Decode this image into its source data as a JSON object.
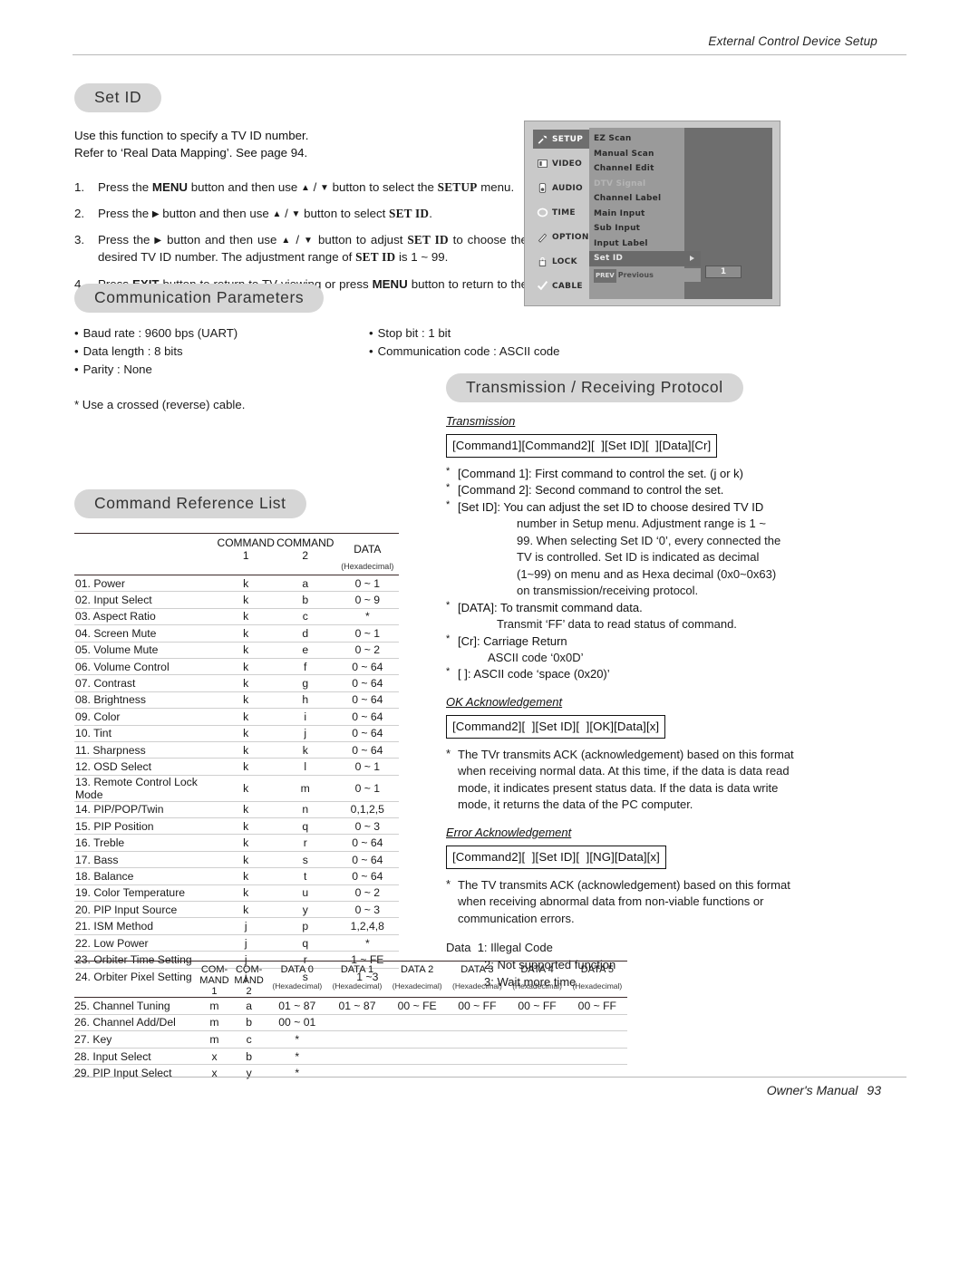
{
  "header": {
    "title": "External Control Device Setup"
  },
  "footer": {
    "manual": "Owner's Manual",
    "page": "93"
  },
  "set_id": {
    "heading": "Set ID",
    "intro_line1": "Use this function to specify a TV ID number.",
    "intro_line2": "Refer to ‘Real Data Mapping’. See page 94.",
    "steps": [
      {
        "num": "1.",
        "parts": [
          "Press the ",
          "MENU",
          " button and then use ",
          "▲",
          " / ",
          "▼",
          " button to select the ",
          "SETUP",
          " menu."
        ]
      },
      {
        "num": "2.",
        "parts": [
          "Press the ",
          "▶",
          " button and then use ",
          "▲",
          " / ",
          "▼",
          " button to select ",
          "SET ID",
          "."
        ]
      },
      {
        "num": "3.",
        "parts": [
          "Press the ",
          "▶",
          " button and then use ",
          "▲",
          " / ",
          "▼",
          " button to adjust ",
          "SET ID",
          " to choose the desired TV ID number. The adjustment range of ",
          "SET ID",
          " is 1 ~ 99."
        ]
      },
      {
        "num": "4.",
        "parts": [
          "Press ",
          "EXIT",
          " button to return to TV viewing or press ",
          "MENU",
          " button to return to the previous menu."
        ]
      }
    ]
  },
  "osd": {
    "sidebar": [
      {
        "label": "SETUP",
        "icon": "wrench-icon",
        "selected": true
      },
      {
        "label": "VIDEO",
        "icon": "screen-icon",
        "selected": false
      },
      {
        "label": "AUDIO",
        "icon": "speaker-icon",
        "selected": false
      },
      {
        "label": "TIME",
        "icon": "clock-icon",
        "selected": false
      },
      {
        "label": "OPTION",
        "icon": "pencil-icon",
        "selected": false
      },
      {
        "label": "LOCK",
        "icon": "lock-icon",
        "selected": false
      },
      {
        "label": "CABLE",
        "icon": "check-icon",
        "selected": false
      }
    ],
    "menu": [
      {
        "label": "EZ Scan",
        "state": "normal"
      },
      {
        "label": "Manual Scan",
        "state": "normal"
      },
      {
        "label": "Channel Edit",
        "state": "normal"
      },
      {
        "label": "DTV Signal",
        "state": "dimmed"
      },
      {
        "label": "Channel Label",
        "state": "normal"
      },
      {
        "label": "Main Input",
        "state": "normal"
      },
      {
        "label": "Sub Input",
        "state": "normal"
      },
      {
        "label": "Input Label",
        "state": "normal"
      },
      {
        "label": "Set ID",
        "state": "highlighted"
      }
    ],
    "previous_key": "PREV",
    "previous_label": "Previous",
    "set_id_value": "1"
  },
  "comm": {
    "heading": "Communication Parameters",
    "left": [
      "Baud rate : 9600 bps (UART)",
      "Data length : 8 bits",
      "Parity : None"
    ],
    "right": [
      "Stop bit : 1 bit",
      "Communication code : ASCII code"
    ],
    "note": "* Use a crossed (reverse) cable."
  },
  "protocol": {
    "heading": "Transmission / Receiving  Protocol",
    "transmission_label": "Transmission",
    "transmission_code": "[Command1][Command2][  ][Set ID][  ][Data][Cr]",
    "notes": [
      {
        "star": "*",
        "text": "[Command 1]: First command to control the set. (j or k)"
      },
      {
        "star": "*",
        "text": "[Command 2]: Second command to control the set."
      },
      {
        "star": "*",
        "text": "[Set ID]: You can adjust the set ID to choose desired TV ID"
      },
      {
        "cont": "number in Setup menu. Adjustment range is 1 ~",
        "indent": "ind1"
      },
      {
        "cont": "99. When selecting Set ID ‘0’, every connected the",
        "indent": "ind1"
      },
      {
        "cont": "TV is controlled. Set ID is indicated as decimal",
        "indent": "ind1"
      },
      {
        "cont": "(1~99) on menu and as Hexa decimal (0x0~0x63)",
        "indent": "ind1"
      },
      {
        "cont": "on transmission/receiving protocol.",
        "indent": "ind1"
      },
      {
        "star": "*",
        "text": "[DATA]: To transmit command data."
      },
      {
        "cont": "Transmit ‘FF’ data to read status of command.",
        "indent": "ind2"
      },
      {
        "star": "*",
        "text": "[Cr]: Carriage Return"
      },
      {
        "cont": "ASCII code ‘0x0D’",
        "indent": "ind3"
      },
      {
        "star": "*",
        "text": "[   ]: ASCII code ‘space (0x20)’"
      }
    ],
    "ok_label": "OK Acknowledgement",
    "ok_code": "[Command2][  ][Set ID][  ][OK][Data][x]",
    "ok_text": "The TVr transmits ACK (acknowledgement) based on this format when receiving normal data. At this time, if the data is data read mode, it indicates present status data. If the data is data write mode, it returns the data of the PC computer.",
    "err_label": "Error Acknowledgement",
    "err_code": "[Command2][  ][Set ID][  ][NG][Data][x]",
    "err_text": "The TV transmits ACK (acknowledgement) based on this format when receiving abnormal data from non-viable functions or communication errors.",
    "data_label": "Data",
    "data_items": [
      "1: Illegal Code",
      "2: Not supported function",
      "3: Wait more time"
    ]
  },
  "command_reference": {
    "heading": "Command Reference List",
    "columns": [
      "",
      "COMMAND 1",
      "COMMAND 2",
      "DATA"
    ],
    "subheader": "(Hexadecimal)",
    "rows": [
      {
        "name": "01. Power",
        "c1": "k",
        "c2": "a",
        "data": "0 ~ 1"
      },
      {
        "name": "02. Input Select",
        "c1": "k",
        "c2": "b",
        "data": "0 ~ 9"
      },
      {
        "name": "03. Aspect Ratio",
        "c1": "k",
        "c2": "c",
        "data": "*"
      },
      {
        "name": "04. Screen Mute",
        "c1": "k",
        "c2": "d",
        "data": "0 ~ 1"
      },
      {
        "name": "05. Volume Mute",
        "c1": "k",
        "c2": "e",
        "data": "0 ~ 2"
      },
      {
        "name": "06. Volume Control",
        "c1": "k",
        "c2": "f",
        "data": "0 ~ 64"
      },
      {
        "name": "07. Contrast",
        "c1": "k",
        "c2": "g",
        "data": "0 ~ 64"
      },
      {
        "name": "08. Brightness",
        "c1": "k",
        "c2": "h",
        "data": "0 ~ 64"
      },
      {
        "name": "09. Color",
        "c1": "k",
        "c2": "i",
        "data": "0 ~ 64"
      },
      {
        "name": "10. Tint",
        "c1": "k",
        "c2": "j",
        "data": "0 ~ 64"
      },
      {
        "name": "11. Sharpness",
        "c1": "k",
        "c2": "k",
        "data": "0 ~ 64"
      },
      {
        "name": "12. OSD Select",
        "c1": "k",
        "c2": "l",
        "data": "0 ~ 1"
      },
      {
        "name": "13. Remote Control Lock Mode",
        "c1": "k",
        "c2": "m",
        "data": "0 ~ 1"
      },
      {
        "name": "14. PIP/POP/Twin",
        "c1": "k",
        "c2": "n",
        "data": "0,1,2,5"
      },
      {
        "name": "15. PIP Position",
        "c1": "k",
        "c2": "q",
        "data": "0 ~ 3"
      },
      {
        "name": "16. Treble",
        "c1": "k",
        "c2": "r",
        "data": "0 ~ 64"
      },
      {
        "name": "17. Bass",
        "c1": "k",
        "c2": "s",
        "data": "0 ~ 64"
      },
      {
        "name": "18. Balance",
        "c1": "k",
        "c2": "t",
        "data": "0 ~ 64"
      },
      {
        "name": "19. Color Temperature",
        "c1": "k",
        "c2": "u",
        "data": "0 ~ 2"
      },
      {
        "name": "20. PIP Input Source",
        "c1": "k",
        "c2": "y",
        "data": "0 ~ 3"
      },
      {
        "name": "21. ISM Method",
        "c1": "j",
        "c2": "p",
        "data": "1,2,4,8"
      },
      {
        "name": "22. Low Power",
        "c1": "j",
        "c2": "q",
        "data": "*"
      },
      {
        "name": "23. Orbiter Time Setting",
        "c1": "j",
        "c2": "r",
        "data": "1 ~ FE"
      },
      {
        "name": "24. Orbiter Pixel Setting",
        "c1": "j",
        "c2": "s",
        "data": "1 ~3"
      }
    ]
  },
  "command_reference2": {
    "columns": [
      "",
      "COM-",
      "COM-",
      "DATA 0",
      "DATA 1",
      "DATA 2",
      "DATA 3",
      "DATA 4",
      "DATA 5"
    ],
    "columns_line2": [
      "",
      "MAND 1",
      "MAND 2",
      "(Hexadecimal)",
      "(Hexadecimal)",
      "(Hexadecimal)",
      "(Hexadecimal)",
      "(Hexadecimal)",
      "(Hexadecimal)"
    ],
    "rows": [
      {
        "name": "25. Channel Tuning",
        "c1": "m",
        "c2": "a",
        "d0": "01 ~ 87",
        "d1": "01 ~ 87",
        "d2": "00 ~ FE",
        "d3": "00 ~ FF",
        "d4": "00 ~ FF",
        "d5": "00 ~ FF"
      },
      {
        "name": "26. Channel Add/Del",
        "c1": "m",
        "c2": "b",
        "d0": "00 ~ 01",
        "d1": "",
        "d2": "",
        "d3": "",
        "d4": "",
        "d5": ""
      },
      {
        "name": "27. Key",
        "c1": "m",
        "c2": "c",
        "d0": "*",
        "d1": "",
        "d2": "",
        "d3": "",
        "d4": "",
        "d5": ""
      },
      {
        "name": "28. Input Select",
        "c1": "x",
        "c2": "b",
        "d0": "*",
        "d1": "",
        "d2": "",
        "d3": "",
        "d4": "",
        "d5": ""
      },
      {
        "name": "29. PIP Input Select",
        "c1": "x",
        "c2": "y",
        "d0": "*",
        "d1": "",
        "d2": "",
        "d3": "",
        "d4": "",
        "d5": ""
      }
    ]
  }
}
